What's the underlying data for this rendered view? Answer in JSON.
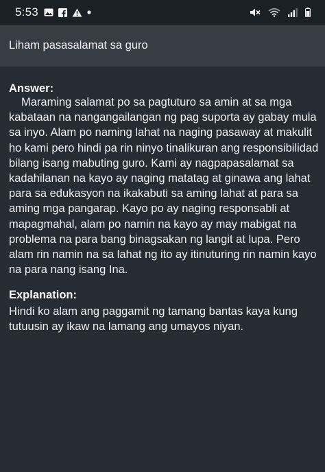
{
  "status_bar": {
    "time": "5:53",
    "left_icons": [
      "image-icon",
      "facebook-icon",
      "warning-icon",
      "dot-icon"
    ],
    "right_icons": [
      "mute-icon",
      "wifi-icon",
      "signal-icon",
      "battery-icon"
    ]
  },
  "header": {
    "title": "Liham pasasalamat sa guro"
  },
  "answer": {
    "label": "Answer:",
    "text": "Maraming salamat po sa pagtuturo sa amin at sa mga kabataan na nangangailangan ng pag suporta ay gabay mula sa inyo. Alam po naming lahat na naging pasaway at makulit ho kami pero hindi pa rin ninyo tinalikuran ang responsibilidad bilang isang mabuting guro. Kami ay nagpapasalamat sa kadahilanan na kayo ay naging matatag at ginawa ang lahat para sa edukasyon na ikakabuti sa aming lahat at para sa aming mga pangarap. Kayo po ay naging responsabli at mapagmahal, alam po namin na kayo ay may mabigat na problema na para bang binagsakan ng langit at lupa. Pero alam rin namin na sa lahat ng ito ay itinuturing rin namin kayo na para nang isang Ina."
  },
  "explanation": {
    "label": "Explanation:",
    "text": "Hindi ko alam ang paggamit ng tamang bantas kaya kung tutuusin ay ikaw na lamang ang umayos niyan."
  },
  "colors": {
    "background": "#262c33",
    "status_bar": "#1b2026",
    "title_bar": "#363d45",
    "text": "#eef1f3"
  }
}
